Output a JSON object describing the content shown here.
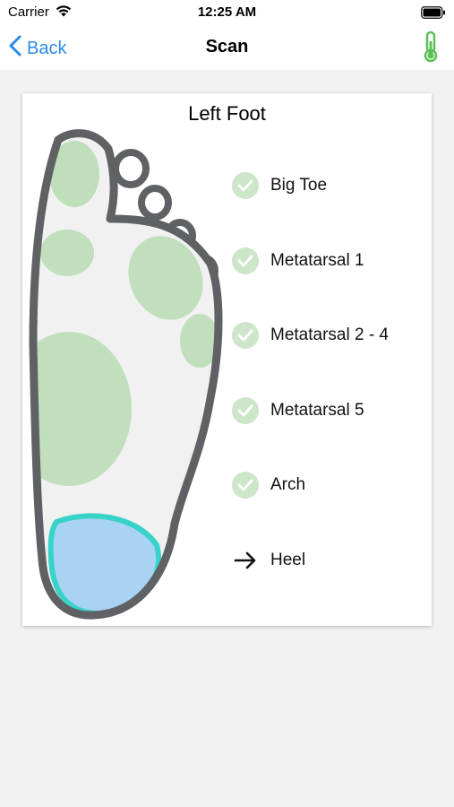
{
  "status_bar": {
    "carrier": "Carrier",
    "time": "12:25 AM"
  },
  "nav": {
    "back_label": "Back",
    "title": "Scan",
    "right_icon": "thermometer-icon",
    "accent_color": "#2a8ae8",
    "thermometer_color": "#5cbf55"
  },
  "card": {
    "title": "Left Foot",
    "regions": [
      {
        "label": "Big Toe",
        "state": "complete",
        "icon": "check-icon"
      },
      {
        "label": "Metatarsal 1",
        "state": "complete",
        "icon": "check-icon"
      },
      {
        "label": "Metatarsal 2 - 4",
        "state": "complete",
        "icon": "check-icon"
      },
      {
        "label": "Metatarsal 5",
        "state": "complete",
        "icon": "check-icon"
      },
      {
        "label": "Arch",
        "state": "complete",
        "icon": "check-icon"
      },
      {
        "label": "Heel",
        "state": "current",
        "icon": "arrow-right-icon"
      }
    ]
  },
  "colors": {
    "complete_fill": "#b9dcb4",
    "current_fill": "#a9d3f5",
    "current_outline": "#37d2c8",
    "foot_outline": "#5f6164"
  }
}
